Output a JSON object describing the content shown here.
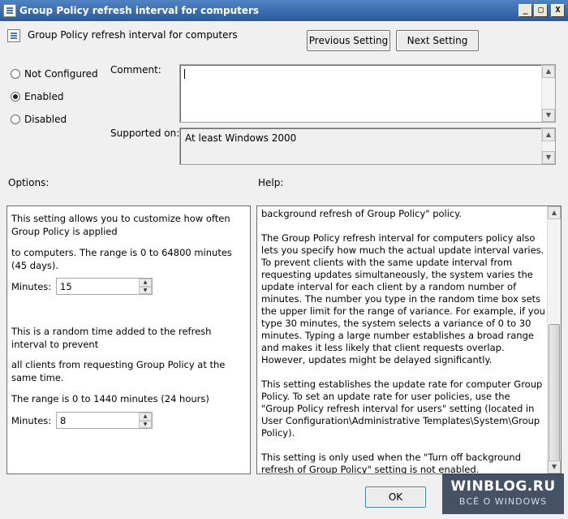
{
  "window": {
    "title": "Group Policy refresh interval for computers",
    "minimize": "_",
    "maximize": "□",
    "close": "X"
  },
  "header": {
    "title": "Group Policy refresh interval for computers",
    "prev_label": "Previous Setting",
    "next_label": "Next Setting"
  },
  "state": {
    "options": [
      {
        "label": "Not Configured",
        "selected": false
      },
      {
        "label": "Enabled",
        "selected": true
      },
      {
        "label": "Disabled",
        "selected": false
      }
    ]
  },
  "comment": {
    "label": "Comment:",
    "value": ""
  },
  "supported": {
    "label": "Supported on:",
    "value": "At least Windows 2000"
  },
  "options_panel": {
    "label": "Options:",
    "text1": "This setting allows you to customize how often Group Policy is applied",
    "text2": "to computers. The range is 0 to 64800 minutes (45 days).",
    "minutes1_label": "Minutes:",
    "minutes1_value": "15",
    "text3": "This is a random time added to the refresh interval to prevent",
    "text4": "all clients from requesting Group Policy at the same time.",
    "text5": "The range is 0 to 1440 minutes (24 hours)",
    "minutes2_label": "Minutes:",
    "minutes2_value": "8"
  },
  "help_panel": {
    "label": "Help:",
    "paragraphs": [
      "background refresh of Group Policy\" policy.",
      "The Group Policy refresh interval for computers policy also lets you specify how much the actual update interval varies. To prevent clients with the same update interval from requesting updates simultaneously, the system varies the update interval for each client by a random number of minutes. The number you type in the random time box sets the upper limit for the range of variance. For example, if you type 30 minutes, the system selects a variance of 0 to 30 minutes. Typing a large number establishes a broad range and makes it less likely that client requests overlap. However, updates might be delayed significantly.",
      "This setting establishes the update rate for computer Group Policy. To set an update rate for user policies, use the \"Group Policy refresh interval for users\" setting (located in User Configuration\\Administrative Templates\\System\\Group Policy).",
      "This setting is only used when the \"Turn off background refresh of Group Policy\" setting is not enabled."
    ]
  },
  "footer": {
    "ok_label": "OK"
  },
  "watermark": {
    "line1": "WINBLOG.RU",
    "line2": "ВСЁ О WINDOWS"
  }
}
